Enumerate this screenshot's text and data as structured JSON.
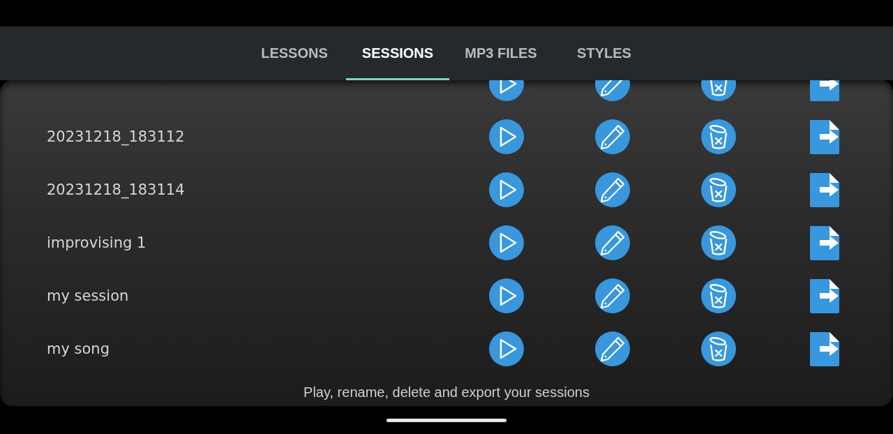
{
  "tabs": [
    {
      "label": "LESSONS",
      "selected": false
    },
    {
      "label": "SESSIONS",
      "selected": true
    },
    {
      "label": "MP3 FILES",
      "selected": false
    },
    {
      "label": "STYLES",
      "selected": false
    }
  ],
  "sessions": [
    {
      "kind": "clipped"
    },
    {
      "kind": "full",
      "name": "20231218_183112"
    },
    {
      "kind": "full",
      "name": "20231218_183114"
    },
    {
      "kind": "full",
      "name": "improvising 1"
    },
    {
      "kind": "full",
      "name": "my session"
    },
    {
      "kind": "full",
      "name": "my song"
    }
  ],
  "hint": "Play, rename, delete and export your sessions"
}
